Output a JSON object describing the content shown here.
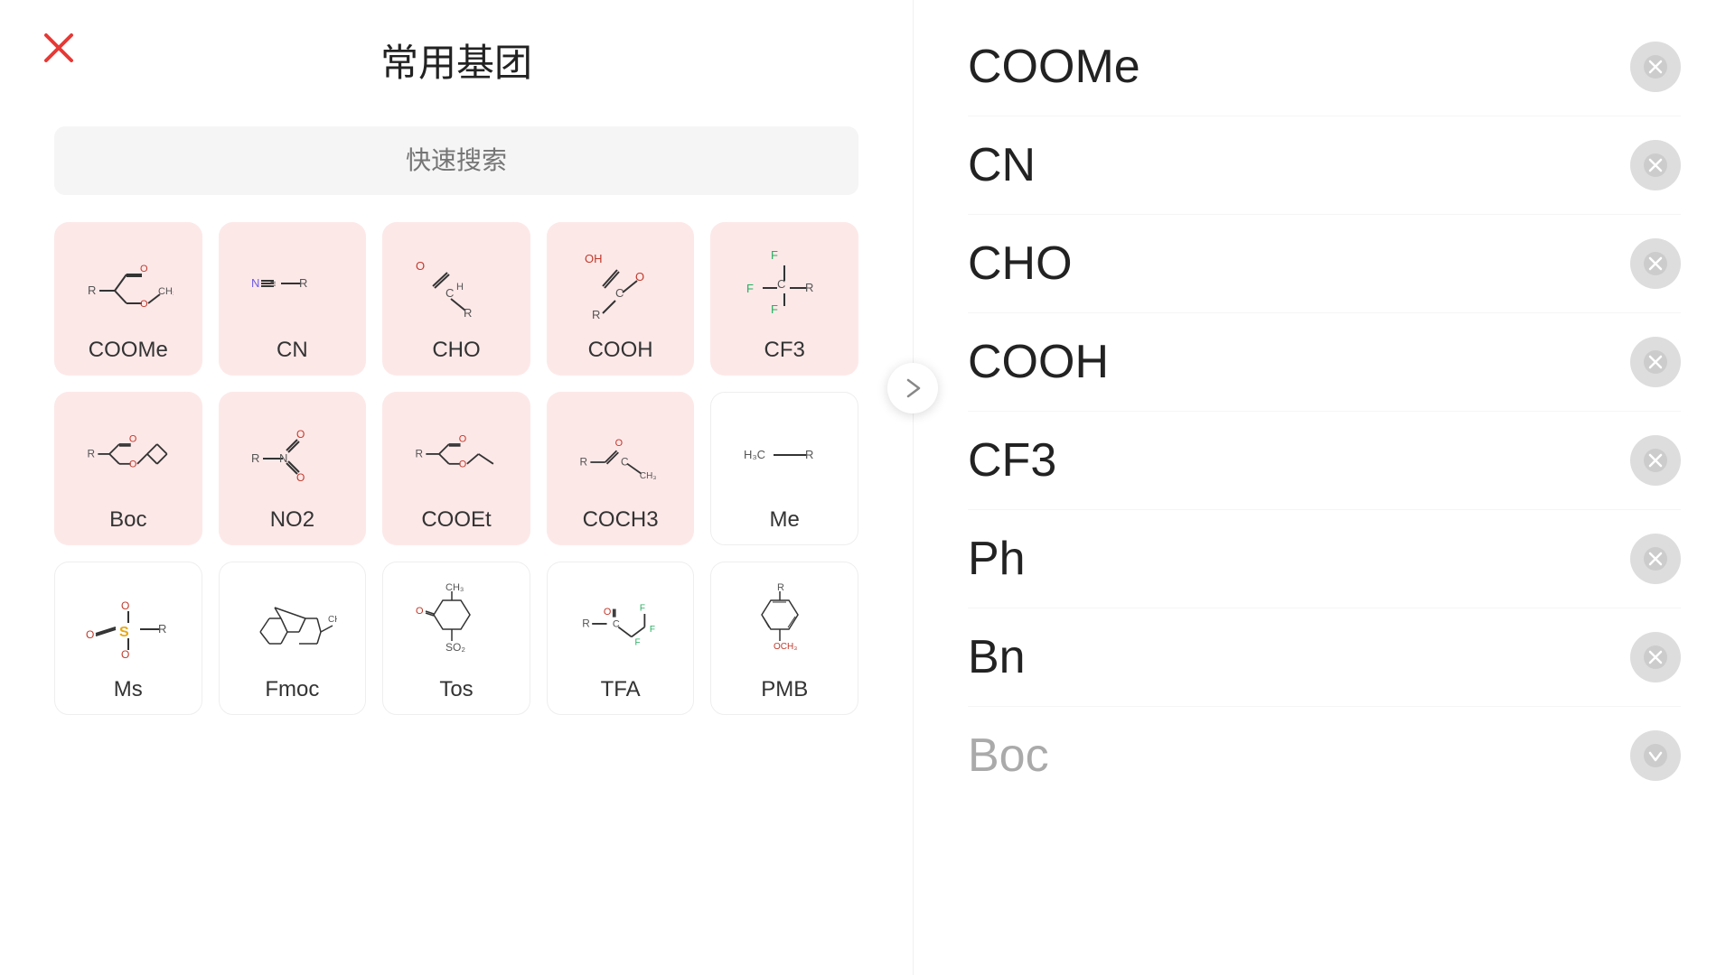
{
  "header": {
    "title": "常用基团",
    "close_icon": "×"
  },
  "search": {
    "placeholder": "快速搜索"
  },
  "grid": {
    "items": [
      {
        "label": "COOMe",
        "type": "pink",
        "svg_key": "coome"
      },
      {
        "label": "CN",
        "type": "pink",
        "svg_key": "cn"
      },
      {
        "label": "CHO",
        "type": "pink",
        "svg_key": "cho"
      },
      {
        "label": "COOH",
        "type": "pink",
        "svg_key": "cooh"
      },
      {
        "label": "CF3",
        "type": "pink",
        "svg_key": "cf3"
      },
      {
        "label": "Boc",
        "type": "pink",
        "svg_key": "boc"
      },
      {
        "label": "NO2",
        "type": "pink",
        "svg_key": "no2"
      },
      {
        "label": "COOEt",
        "type": "pink",
        "svg_key": "cooet"
      },
      {
        "label": "COCH3",
        "type": "pink",
        "svg_key": "coch3"
      },
      {
        "label": "Me",
        "type": "white",
        "svg_key": "me"
      },
      {
        "label": "Ms",
        "type": "white",
        "svg_key": "ms"
      },
      {
        "label": "Fmoc",
        "type": "white",
        "svg_key": "fmoc"
      },
      {
        "label": "Tos",
        "type": "white",
        "svg_key": "tos"
      },
      {
        "label": "TFA",
        "type": "white",
        "svg_key": "tfa"
      },
      {
        "label": "PMB",
        "type": "white",
        "svg_key": "pmb"
      }
    ]
  },
  "right_panel": {
    "items": [
      {
        "label": "COOMe",
        "visible": true
      },
      {
        "label": "CN",
        "visible": true
      },
      {
        "label": "CHO",
        "visible": true
      },
      {
        "label": "COOH",
        "visible": true
      },
      {
        "label": "CF3",
        "visible": true
      },
      {
        "label": "Ph",
        "visible": true
      },
      {
        "label": "Bn",
        "visible": true
      },
      {
        "label": "Boc",
        "visible": false,
        "partial": true
      }
    ]
  },
  "colors": {
    "pink_card": "#fde8e8",
    "accent_red": "#e53935",
    "text_dark": "#222222",
    "text_gray": "#999999"
  }
}
